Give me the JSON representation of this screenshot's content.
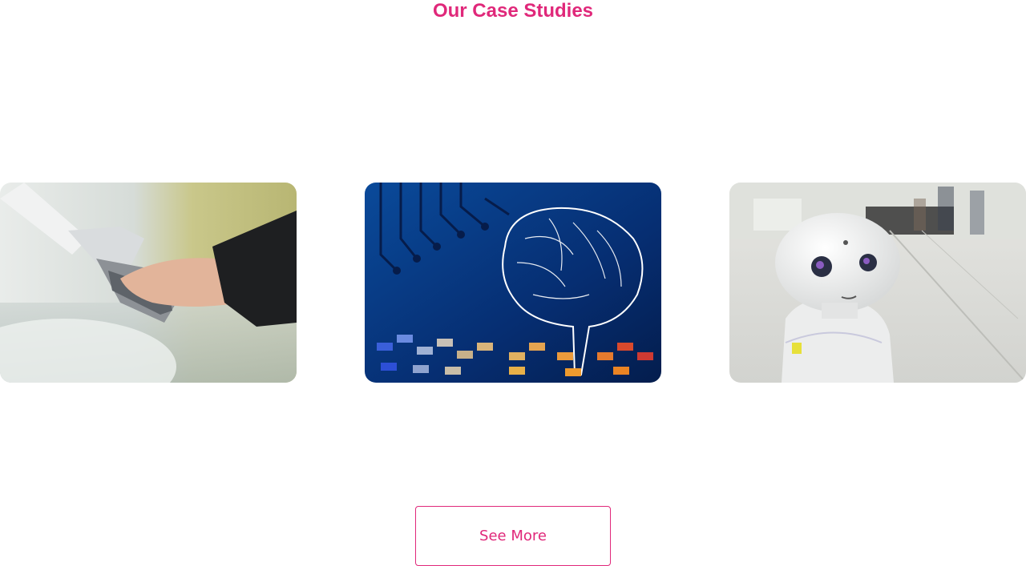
{
  "section": {
    "title": "Our Case Studies"
  },
  "cards": [
    {
      "image": "robot-hand-touching-human-hand-photo"
    },
    {
      "image": "circuit-brain-illustration"
    },
    {
      "image": "white-humanoid-robot-photo"
    }
  ],
  "actions": {
    "see_more_label": "See More"
  },
  "colors": {
    "accent": "#e0287a",
    "background": "#ffffff"
  }
}
